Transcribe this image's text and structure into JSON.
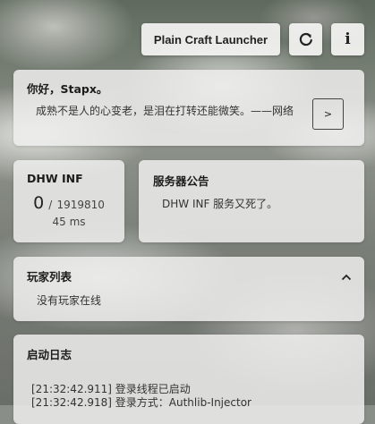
{
  "toolbar": {
    "launcher_label": "Plain Craft Launcher",
    "refresh_icon": "refresh-icon",
    "info_icon": "info-icon",
    "info_glyph": "i"
  },
  "greeting": {
    "title": "你好，Stapx。",
    "quote": "成熟不是人的心变老，是泪在打转还能微笑。——网络",
    "arrow_label": ">"
  },
  "server": {
    "name": "DHW INF",
    "online": "0",
    "separator": "/",
    "max": "1919810",
    "ping": "45 ms"
  },
  "announcement": {
    "title": "服务器公告",
    "text": "DHW INF 服务又死了。"
  },
  "players": {
    "title": "玩家列表",
    "empty_text": "没有玩家在线",
    "collapse_icon": "chevron-up-icon"
  },
  "log": {
    "title": "启动日志",
    "lines": [
      "[21:32:42.911] 登录线程已启动",
      "[21:32:42.918] 登录方式：Authlib-Injector"
    ]
  }
}
